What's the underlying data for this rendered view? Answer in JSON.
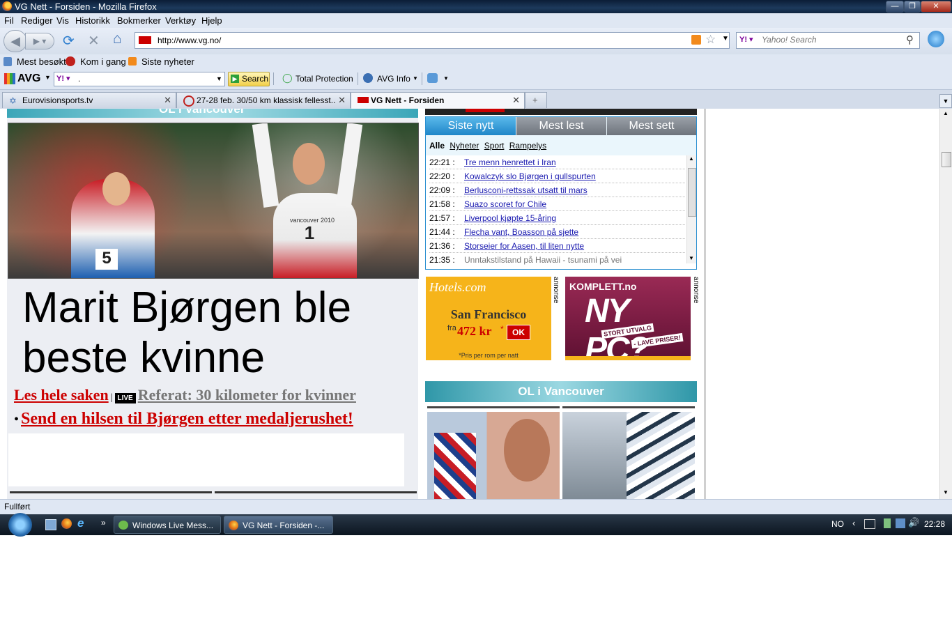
{
  "window": {
    "title": "VG Nett - Forsiden - Mozilla Firefox"
  },
  "menu": [
    "Fil",
    "Rediger",
    "Vis",
    "Historikk",
    "Bokmerker",
    "Verktøy",
    "Hjelp"
  ],
  "nav": {
    "url": "http://www.vg.no/",
    "search_placeholder": "Yahoo! Search"
  },
  "bookmarks": [
    "Mest besøkt",
    "Kom i gang",
    "Siste nyheter"
  ],
  "avg": {
    "brand": "AVG",
    "search_value": ".",
    "search_button": "Search",
    "total_protection": "Total Protection",
    "info": "AVG Info"
  },
  "tabs": [
    {
      "label": "Eurovisionsports.tv"
    },
    {
      "label": "27-28 feb. 30/50 km klassisk fellesst..."
    },
    {
      "label": "VG Nett - Forsiden"
    }
  ],
  "article": {
    "section_header": "OL i Vancouver",
    "headline_line1": "Marit Bjørgen ble",
    "headline_line2": "beste kvinne",
    "read_more": "Les hele saken",
    "separator": "|",
    "live_badge": "LIVE",
    "referat": "Referat: 30 kilometer for kvinner",
    "bullet_link": "Send en hilsen til Bjørgen etter medaljerushet!",
    "photo_bib_left": "5",
    "photo_bib_right": "1",
    "photo_text": "vancouver 2010"
  },
  "news": {
    "tabs": [
      "Siste nytt",
      "Mest lest",
      "Mest sett"
    ],
    "filters": [
      "Alle",
      "Nyheter",
      "Sport",
      "Rampelys"
    ],
    "items": [
      {
        "time": "22:21 :",
        "title": "Tre menn henrettet i Iran"
      },
      {
        "time": "22:20 :",
        "title": "Kowalczyk slo Bjørgen i gullspurten"
      },
      {
        "time": "22:09 :",
        "title": "Berlusconi-rettssak utsatt til mars"
      },
      {
        "time": "21:58 :",
        "title": "Suazo scoret for Chile"
      },
      {
        "time": "21:57 :",
        "title": "Liverpool kjøpte 15-åring"
      },
      {
        "time": "21:44 :",
        "title": "Flecha vant, Boasson på sjette"
      },
      {
        "time": "21:36 :",
        "title": "Storseier for Aasen, til liten nytte"
      },
      {
        "time": "21:35 :",
        "title": "Unntakstilstand på Hawaii - tsunami på vei"
      }
    ]
  },
  "ads": {
    "hotels_brand": "Hotels.com",
    "hotels_city": "San Francisco",
    "hotels_fra": "fra",
    "hotels_price": "472 kr",
    "hotels_star": "*",
    "hotels_ok": "OK",
    "hotels_note": "*Pris per rom per natt",
    "annonse": "annonse",
    "komplett_brand": "KOMPLETT.no",
    "komplett_headline": "NY PC?",
    "komplett_sub1": "STORT UTVALG",
    "komplett_sub2": "- LAVE PRISER!"
  },
  "ol_header": "OL i Vancouver",
  "status": "Fullført",
  "taskbar": {
    "items": [
      "Windows Live Mess...",
      "VG Nett - Forsiden -..."
    ],
    "lang": "NO",
    "clock": "22:28"
  },
  "colors": {
    "vg_red": "#cc0000",
    "link_blue": "#1a1ab0",
    "news_tab_blue": "#2a8fd0",
    "hotels_yellow": "#f6b41a",
    "komplett_purple": "#7a1840"
  }
}
